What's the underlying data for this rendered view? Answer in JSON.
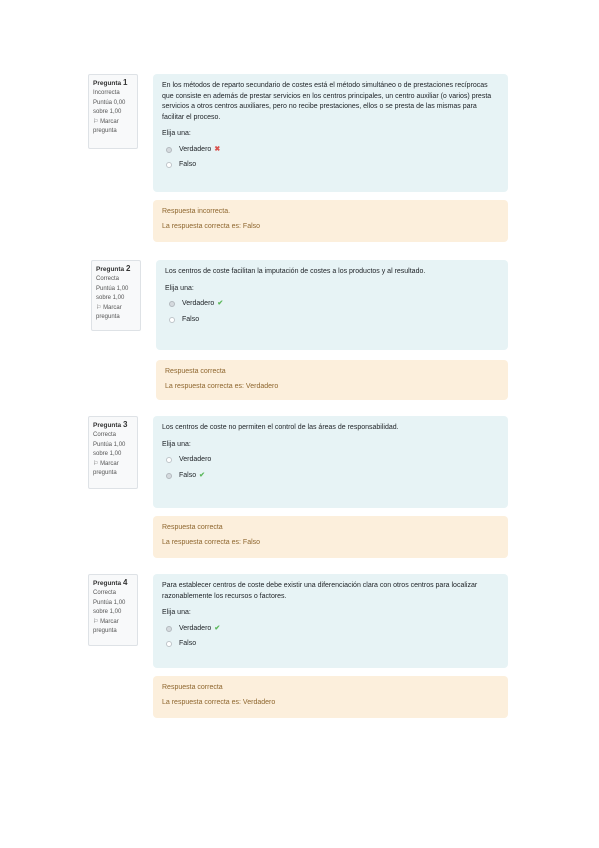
{
  "questions": [
    {
      "qlabel": "Pregunta",
      "number": "1",
      "state": "Incorrecta",
      "grade": "Puntúa 0,00 sobre 1,00",
      "flag": "Marcar pregunta",
      "text": "En los métodos de reparto secundario de costes está el método simultáneo o de prestaciones recíprocas que consiste en además de prestar servicios en los centros principales, un centro auxiliar (o varios) presta servicios a otros centros auxiliares, pero no recibe prestaciones, ellos o se presta de las mismas para facilitar el proceso.",
      "prompt": "Elija una:",
      "options": [
        {
          "label": "Verdadero",
          "checked": true,
          "mark": "✖"
        },
        {
          "label": "Falso",
          "checked": false,
          "mark": ""
        }
      ],
      "feedback": "Respuesta incorrecta.",
      "right_answer": "La respuesta correcta es: Falso"
    },
    {
      "qlabel": "Pregunta",
      "number": "2",
      "state": "Correcta",
      "grade": "Puntúa 1,00 sobre 1,00",
      "flag": "Marcar pregunta",
      "text": "Los centros de coste facilitan la imputación de costes a los productos y al resultado.",
      "prompt": "Elija una:",
      "options": [
        {
          "label": "Verdadero",
          "checked": true,
          "mark": "✔"
        },
        {
          "label": "Falso",
          "checked": false,
          "mark": ""
        }
      ],
      "feedback": "Respuesta correcta",
      "right_answer": "La respuesta correcta es: Verdadero"
    },
    {
      "qlabel": "Pregunta",
      "number": "3",
      "state": "Correcta",
      "grade": "Puntúa 1,00 sobre 1,00",
      "flag": "Marcar pregunta",
      "text": "Los centros de coste no permiten el control de las áreas de responsabilidad.",
      "prompt": "Elija una:",
      "options": [
        {
          "label": "Verdadero",
          "checked": false,
          "mark": ""
        },
        {
          "label": "Falso",
          "checked": true,
          "mark": "✔"
        }
      ],
      "feedback": "Respuesta correcta",
      "right_answer": "La respuesta correcta es: Falso"
    },
    {
      "qlabel": "Pregunta",
      "number": "4",
      "state": "Correcta",
      "grade": "Puntúa 1,00 sobre 1,00",
      "flag": "Marcar pregunta",
      "text": "Para establecer centros de coste debe existir una diferenciación clara con otros centros para localizar razonablemente los recursos o factores.",
      "prompt": "Elija una:",
      "options": [
        {
          "label": "Verdadero",
          "checked": true,
          "mark": "✔"
        },
        {
          "label": "Falso",
          "checked": false,
          "mark": ""
        }
      ],
      "feedback": "Respuesta correcta",
      "right_answer": "La respuesta correcta es: Verdadero"
    }
  ]
}
